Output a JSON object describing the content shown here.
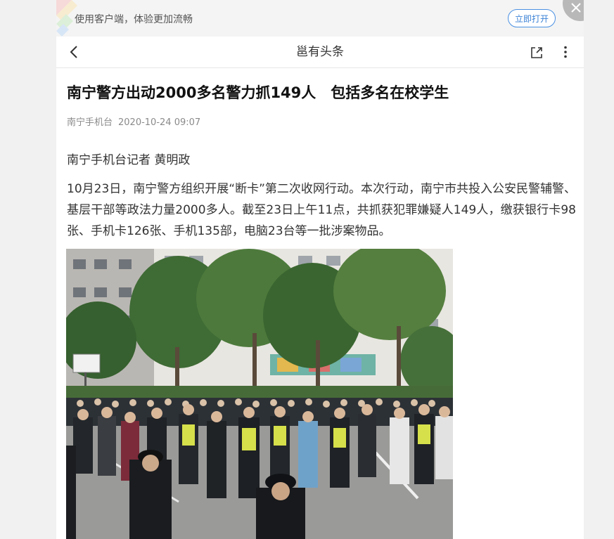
{
  "promo": {
    "text": "使用客户端，体验更加流畅",
    "open_button": "立即打开"
  },
  "nav": {
    "title": "邕有头条"
  },
  "article": {
    "title": "南宁警方出动2000多名警力抓149人　包括多名在校学生",
    "source": "南宁手机台",
    "date": "2020-10-24 09:07",
    "byline": "南宁手机台记者 黄明政",
    "paragraph": "10月23日，南宁警方组织开展“断卡”第二次收网行动。本次行动，南宁市共投入公安民警辅警、基层干部等政法力量2000多人。截至23日上午11点，共抓获犯罪嫌疑人149人，缴获银行卡98张、手机卡126张、手机135部，电脑23台等一批涉案物品。"
  },
  "colors": {
    "accent": "#3b82d6",
    "meta": "#8a8a8a",
    "text": "#333333"
  }
}
